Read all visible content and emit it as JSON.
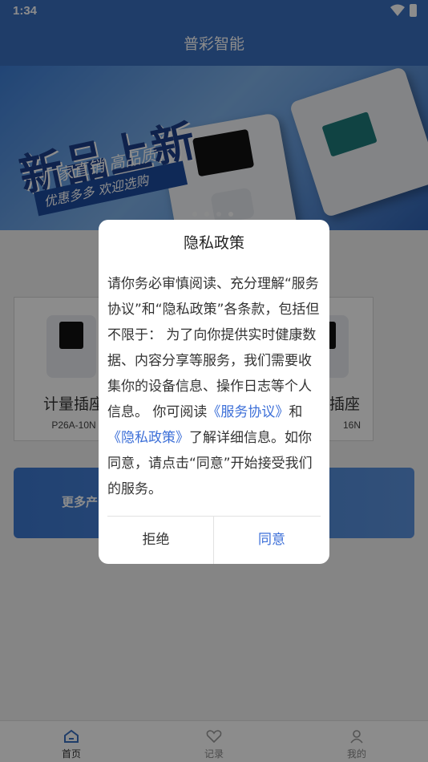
{
  "status_bar": {
    "time": "1:34"
  },
  "app_bar": {
    "title": "普彩智能"
  },
  "banner": {
    "headline": "新品上新",
    "subline": "厂家直销 高品质",
    "strip": "优惠多多 欢迎选购",
    "active_slide": 4,
    "slide_count": 4
  },
  "products": [
    {
      "name": "计量插座",
      "model": "P26A-10N"
    },
    {
      "name": "插座",
      "model": "16N"
    }
  ],
  "more_banner": {
    "label": "更多产"
  },
  "dialog": {
    "title": "隐私政策",
    "body_part1": "请你务必审慎阅读、充分理解“服务协议”和“隐私政策”各条款，包括但不限于： 为了向你提供实时健康数据、内容分享等服务，我们需要收集你的设备信息、操作日志等个人信息。 你可阅读",
    "link_service": "《服务协议》",
    "body_and": "和",
    "link_privacy": "《隐私政策》",
    "body_part2": "了解详细信息。如你同意，请点击“同意”开始接受我们的服务。",
    "reject_label": "拒绝",
    "agree_label": "同意",
    "accent_color": "#3c6fd8"
  },
  "bottom_nav": {
    "items": [
      {
        "label": "首页",
        "icon": "home-icon"
      },
      {
        "label": "记录",
        "icon": "heart-icon"
      },
      {
        "label": "我的",
        "icon": "user-icon"
      }
    ]
  }
}
